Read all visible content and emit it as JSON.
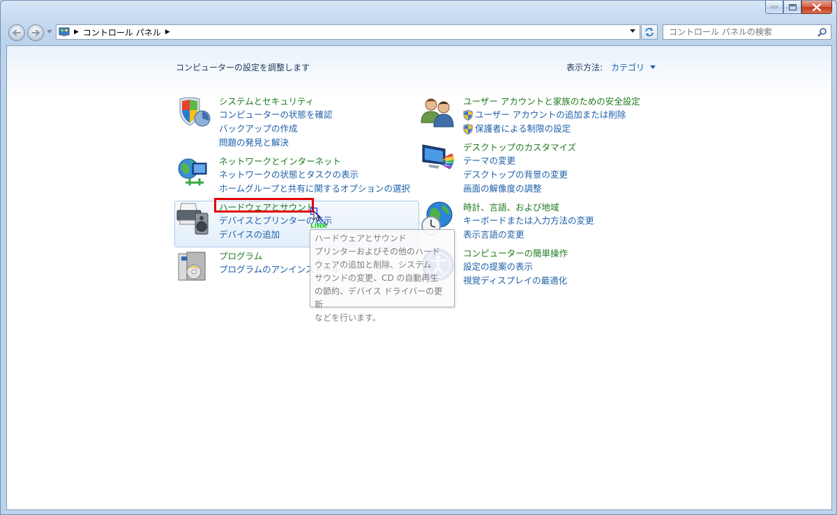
{
  "address": {
    "breadcrumb": [
      "コントロール パネル"
    ]
  },
  "search": {
    "placeholder": "コントロール パネルの検索"
  },
  "header": {
    "title": "コンピューターの設定を調整します",
    "view_label": "表示方法:",
    "view_value": "カテゴリ"
  },
  "categories": [
    {
      "title": "システムとセキュリティ",
      "links": [
        "コンピューターの状態を確認",
        "バックアップの作成",
        "問題の発見と解決"
      ]
    },
    {
      "title": "ネットワークとインターネット",
      "links": [
        "ネットワークの状態とタスクの表示",
        "ホームグループと共有に関するオプションの選択"
      ]
    },
    {
      "title": "ハードウェアとサウンド",
      "links": [
        "デバイスとプリンターの表示",
        "デバイスの追加"
      ]
    },
    {
      "title": "プログラム",
      "links": [
        "プログラムのアンインストール"
      ]
    },
    {
      "title": "ユーザー アカウントと家族のための安全設定",
      "links": [
        "ユーザー アカウントの追加または削除",
        "保護者による制限の設定"
      ]
    },
    {
      "title": "デスクトップのカスタマイズ",
      "links": [
        "テーマの変更",
        "デスクトップの背景の変更",
        "画面の解像度の調整"
      ]
    },
    {
      "title": "時計、言語、および地域",
      "links": [
        "キーボードまたは入力方法の変更",
        "表示言語の変更"
      ]
    },
    {
      "title": "コンピューターの簡単操作",
      "links": [
        "設定の提案の表示",
        "視覚ディスプレイの最適化"
      ]
    }
  ],
  "tooltip": {
    "lines": [
      "ハードウェアとサウンド",
      "プリンターおよびその他のハード",
      "ウェアの追加と削除、システム",
      "サウンドの変更、CD の自動再生",
      "の節約、デバイス ドライバーの更新",
      "などを行います。"
    ]
  },
  "cursor_label": "LINK",
  "colors": {
    "link": "#1c5fa8",
    "category_title": "#1e7a1e",
    "highlight_red": "#e00000"
  }
}
